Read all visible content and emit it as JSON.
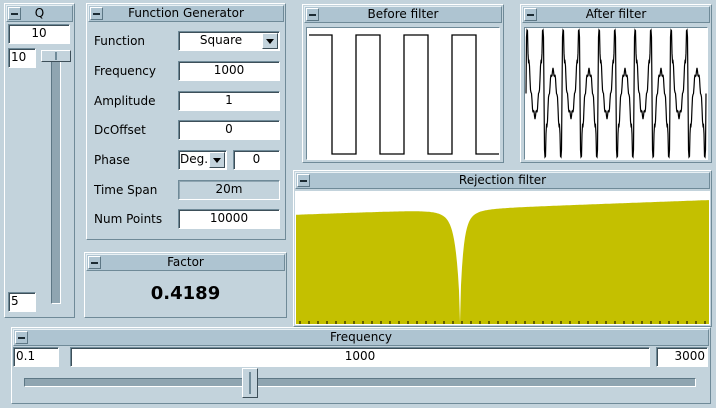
{
  "q_panel": {
    "title": "Q",
    "value": "10",
    "slider_max_label": "10",
    "slider_min_label": "5",
    "slider_level": 1.0
  },
  "function_generator": {
    "title": "Function Generator",
    "function_label": "Function",
    "function_value": "Square",
    "frequency_label": "Frequency",
    "frequency_value": "1000",
    "amplitude_label": "Amplitude",
    "amplitude_value": "1",
    "dcoffset_label": "DcOffset",
    "dcoffset_value": "0",
    "phase_label": "Phase",
    "phase_unit": "Deg.",
    "phase_value": "0",
    "timespan_label": "Time Span",
    "timespan_value": "20m",
    "numpoints_label": "Num Points",
    "numpoints_value": "10000"
  },
  "factor": {
    "title": "Factor",
    "value": "0.4189"
  },
  "before_filter": {
    "title": "Before  filter"
  },
  "after_filter": {
    "title": "After  filter"
  },
  "rejection_filter": {
    "title": "Rejection  filter",
    "fill_color": "#c4c000"
  },
  "frequency": {
    "title": "Frequency",
    "min": "0.1",
    "current": "1000",
    "max": "3000",
    "slider_fraction": 0.333
  }
}
